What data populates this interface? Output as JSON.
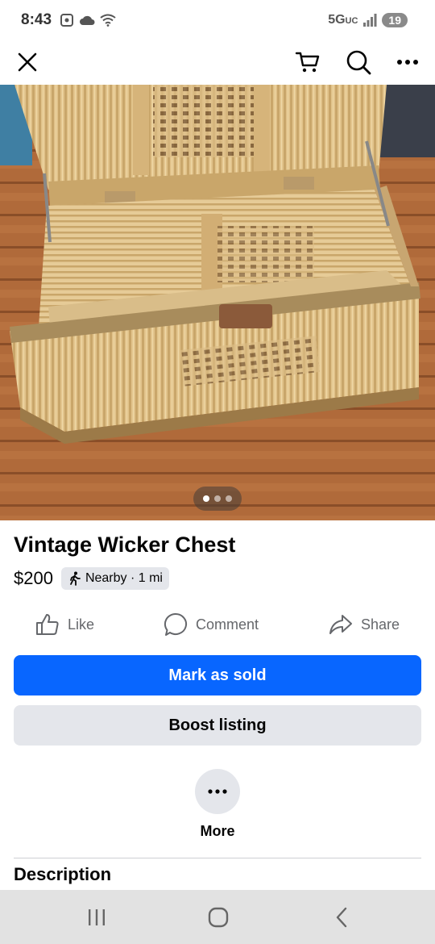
{
  "status_bar": {
    "time": "8:43",
    "network": "5G",
    "network_suffix": "UC",
    "battery": "19"
  },
  "toolbar": {
    "close_icon": "close-icon",
    "cart_icon": "cart-icon",
    "search_icon": "search-icon",
    "more_icon": "more-horizontal-icon"
  },
  "photo": {
    "description": "wicker-chest-photo",
    "page_count": 3,
    "current_page": 1
  },
  "listing": {
    "title": "Vintage Wicker Chest",
    "price": "$200",
    "location_chip": "Nearby · 1 mi"
  },
  "actions": {
    "like": "Like",
    "comment": "Comment",
    "share": "Share"
  },
  "buttons": {
    "mark_as_sold": "Mark as sold",
    "boost_listing": "Boost listing",
    "more": "More"
  },
  "sections": {
    "description_heading": "Description"
  },
  "colors": {
    "primary": "#0866ff",
    "secondary_bg": "#e4e6eb",
    "muted_text": "#65676b"
  }
}
